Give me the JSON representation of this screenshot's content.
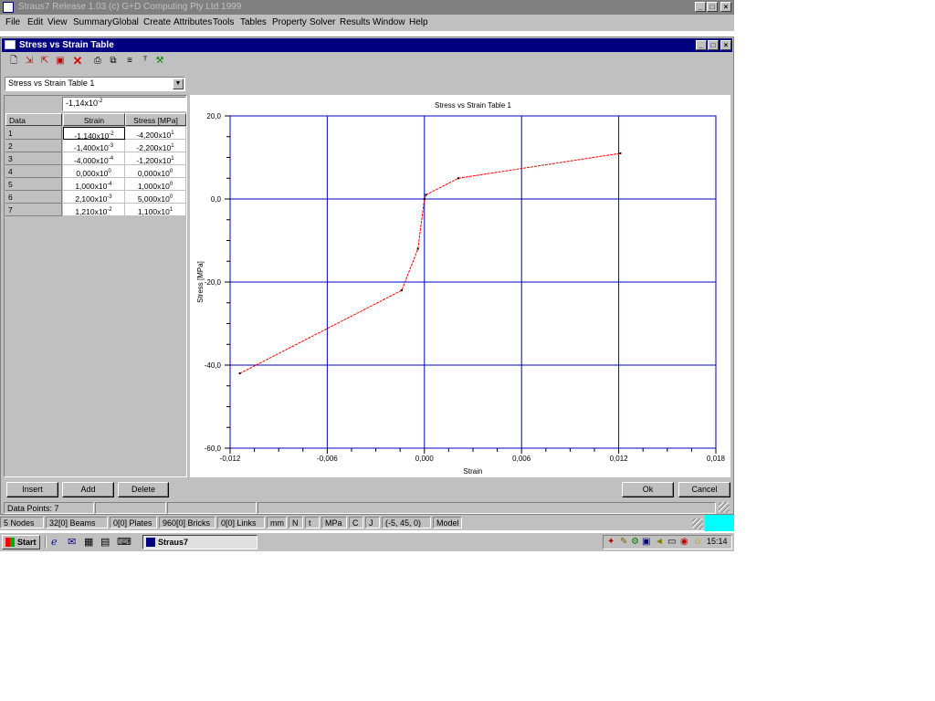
{
  "app": {
    "title": "Straus7 Release 1.03 (c) G+D Computing Pty Ltd 1999",
    "menu": [
      "File",
      "Edit",
      "View",
      "Summary",
      "Global",
      "Create",
      "Attributes",
      "Tools",
      "Tables",
      "Property",
      "Solver",
      "Results",
      "Window",
      "Help"
    ]
  },
  "dialog": {
    "title": "Stress vs Strain Table",
    "table_select": "Stress vs Strain Table 1",
    "edit_value": "-1,14x10",
    "edit_exp": "-2",
    "columns": [
      "Data",
      "Strain",
      "Stress [MPa]"
    ],
    "rows": [
      {
        "id": "1",
        "strain": "-1,140x10",
        "se": "-2",
        "stress": "-4,200x10",
        "te": "1"
      },
      {
        "id": "2",
        "strain": "-1,400x10",
        "se": "-3",
        "stress": "-2,200x10",
        "te": "1"
      },
      {
        "id": "3",
        "strain": "-4,000x10",
        "se": "-4",
        "stress": "-1,200x10",
        "te": "1"
      },
      {
        "id": "4",
        "strain": "0,000x10",
        "se": "0",
        "stress": "0,000x10",
        "te": "0"
      },
      {
        "id": "5",
        "strain": "1,000x10",
        "se": "-4",
        "stress": "1,000x10",
        "te": "0"
      },
      {
        "id": "6",
        "strain": "2,100x10",
        "se": "-3",
        "stress": "5,000x10",
        "te": "0"
      },
      {
        "id": "7",
        "strain": "1,210x10",
        "se": "-2",
        "stress": "1,100x10",
        "te": "1"
      }
    ],
    "buttons": {
      "insert": "Insert",
      "add": "Add",
      "delete": "Delete",
      "ok": "Ok",
      "cancel": "Cancel"
    },
    "status": "Data Points: 7"
  },
  "chart_data": {
    "type": "line",
    "title": "Stress vs Strain Table 1",
    "xlabel": "Strain",
    "ylabel": "Stress [MPa]",
    "xlim": [
      -0.012,
      0.018
    ],
    "ylim": [
      -60,
      20
    ],
    "xticks": [
      "-0,012",
      "-0,006",
      "0,000",
      "0,006",
      "0,012",
      "0,018"
    ],
    "yticks": [
      "20,0",
      "0,0",
      "-20,0",
      "-40,0",
      "-60,0"
    ],
    "x": [
      -0.0114,
      -0.0014,
      -0.0004,
      0.0,
      0.0001,
      0.0021,
      0.0121
    ],
    "y": [
      -42,
      -22,
      -12,
      0,
      1,
      5,
      11
    ],
    "line_color": "#ff0000",
    "grid_color": "#0000c0",
    "grid": true
  },
  "app_status": [
    "5 Nodes",
    "32[0] Beams",
    "0[0] Plates",
    "960[0] Bricks",
    "0[0] Links",
    "mm",
    "N",
    "t",
    "MPa",
    "C",
    "J",
    "(-5, 45, 0)",
    "Model"
  ],
  "taskbar": {
    "start": "Start",
    "task": "Straus7",
    "clock": "15:14"
  }
}
